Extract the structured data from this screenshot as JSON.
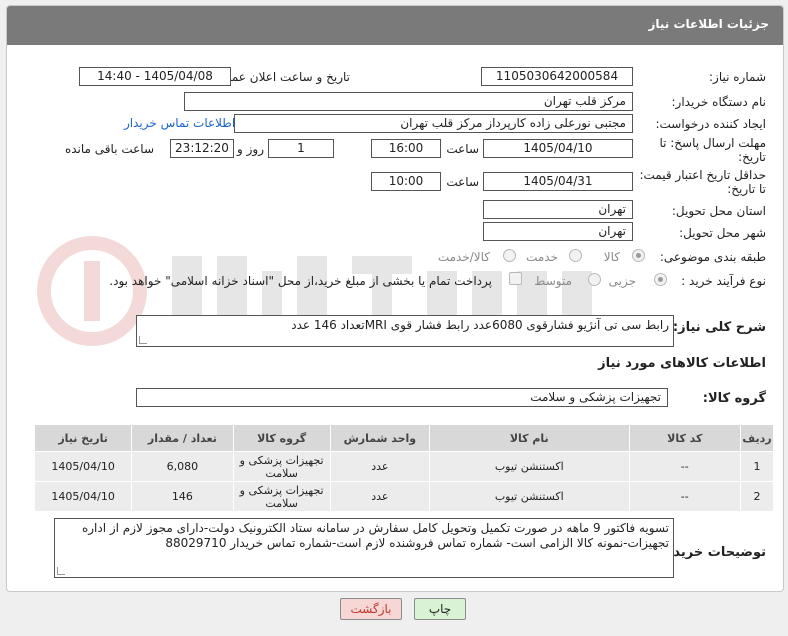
{
  "page_title": "جزئیات اطلاعات نیاز",
  "fields": {
    "need_number_label": "شماره نیاز:",
    "need_number": "1105030642000584",
    "announce_label": "تاریخ و ساعت اعلان عمومی:",
    "announce_value": "1405/04/08 - 14:40",
    "buyer_org_label": "نام دستگاه خریدار:",
    "buyer_org": "مرکز قلب تهران",
    "creator_label": "ایجاد کننده درخواست:",
    "creator": "مجتبی نورعلی زاده کارپرداز مرکز قلب تهران",
    "contact_link": "اطلاعات تماس خریدار",
    "deadline_label_1": "مهلت ارسال پاسخ: تا",
    "deadline_label_2": "تاریخ:",
    "deadline_date": "1405/04/10",
    "time_label": "ساعت",
    "deadline_time": "16:00",
    "days_value": "1",
    "days_label": "روز و",
    "remaining_time": "23:12:20",
    "remaining_label": "ساعت باقی مانده",
    "min_price_label_1": "حداقل تاریخ اعتبار قیمت:",
    "min_price_label_2": "تا تاریخ:",
    "min_price_date": "1405/04/31",
    "min_price_time": "10:00",
    "province_label": "استان محل تحویل:",
    "province": "تهران",
    "city_label": "شهر محل تحویل:",
    "city": "تهران",
    "category_label": "طبقه بندی موضوعی:",
    "category_options": [
      "کالا",
      "خدمت",
      "کالا/خدمت"
    ],
    "process_label": "نوع فرآیند خرید :",
    "process_options": [
      "جزیی",
      "متوسط"
    ],
    "payment_note": "پرداخت تمام یا بخشی از مبلغ خرید،از محل \"اسناد خزانه اسلامی\" خواهد بود."
  },
  "description": {
    "label": "شرح کلی نیاز:",
    "text": "رابط سی تی آنژیو فشارقوی 6080عدد رابط فشار قوی MRIتعداد 146 عدد"
  },
  "goods_info_title": "اطلاعات کالاهای مورد نیاز",
  "goods_group": {
    "label": "گروه کالا:",
    "value": "تجهیزات پزشکی و سلامت"
  },
  "table": {
    "headers": [
      "ردیف",
      "کد کالا",
      "نام کالا",
      "واحد شمارش",
      "گروه کالا",
      "تعداد / مقدار",
      "تاریخ نیاز"
    ],
    "rows": [
      [
        "1",
        "--",
        "اکستنشن تیوب",
        "عدد",
        "تجهیزات پزشکی و سلامت",
        "6,080",
        "1405/04/10"
      ],
      [
        "2",
        "--",
        "اکستنشن تیوب",
        "عدد",
        "تجهیزات پزشکی و سلامت",
        "146",
        "1405/04/10"
      ]
    ]
  },
  "buyer_notes": {
    "label": "توضیحات خریدار:",
    "text": "تسویه فاکتور 9 ماهه در صورت تکمیل وتحویل کامل سفارش در سامانه  ستاد الکترونیک دولت-دارای مجوز لازم از اداره تجهیزات-نمونه کالا الزامی است- شماره تماس فروشنده لازم است-شماره تماس خریدار 88029710"
  },
  "buttons": {
    "print": "چاپ",
    "back": "بازگشت"
  },
  "colors": {
    "titlebar": "#7a7a7a",
    "link": "#1d66c9",
    "back_button": "#f7d6d6",
    "print_button": "#d9f2d3"
  }
}
